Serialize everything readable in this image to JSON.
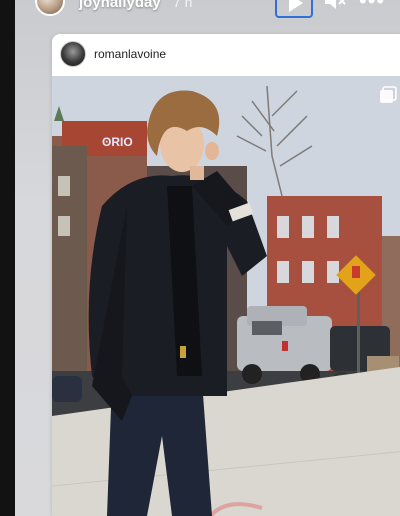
{
  "story": {
    "username": "joyhallyday",
    "time": "7 h",
    "icons": {
      "play": "play-icon",
      "mute": "mute-icon",
      "more": "more-icon"
    }
  },
  "post": {
    "username": "romanlavoine",
    "icons": {
      "multi": "multi-photo-icon"
    }
  },
  "colors": {
    "accent": "#2f6fd6",
    "background": "#121212"
  }
}
